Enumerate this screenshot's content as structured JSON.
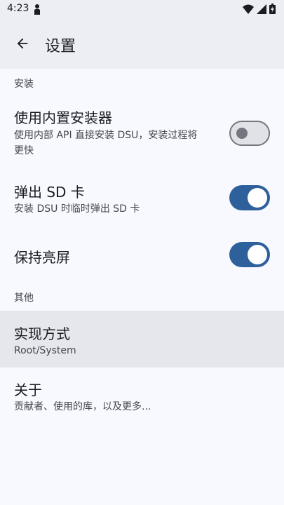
{
  "status_bar": {
    "time": "4:23",
    "icons": [
      "notification-icon",
      "wifi-icon",
      "signal-icon",
      "battery-icon"
    ]
  },
  "app_bar": {
    "title": "设置",
    "back_icon": "arrow-back-icon"
  },
  "sections": {
    "install": {
      "header": "安装",
      "items": [
        {
          "title": "使用内置安装器",
          "summary_line1": "使用内部 API 直接安装 DSU，安装过程将",
          "summary_line2": "更快",
          "switch_on": false
        },
        {
          "title": "弹出 SD 卡",
          "summary": "安装 DSU 时临时弹出 SD 卡",
          "switch_on": true
        },
        {
          "title": "保持亮屏",
          "switch_on": true
        }
      ]
    },
    "other": {
      "header": "其他",
      "items": [
        {
          "title": "实现方式",
          "summary": "Root/System"
        },
        {
          "title": "关于",
          "summary": "贡献者、使用的库，以及更多..."
        }
      ]
    }
  },
  "colors": {
    "accent": "#2e609b",
    "background": "#f8f9ff",
    "app_bar": "#eceef4"
  }
}
